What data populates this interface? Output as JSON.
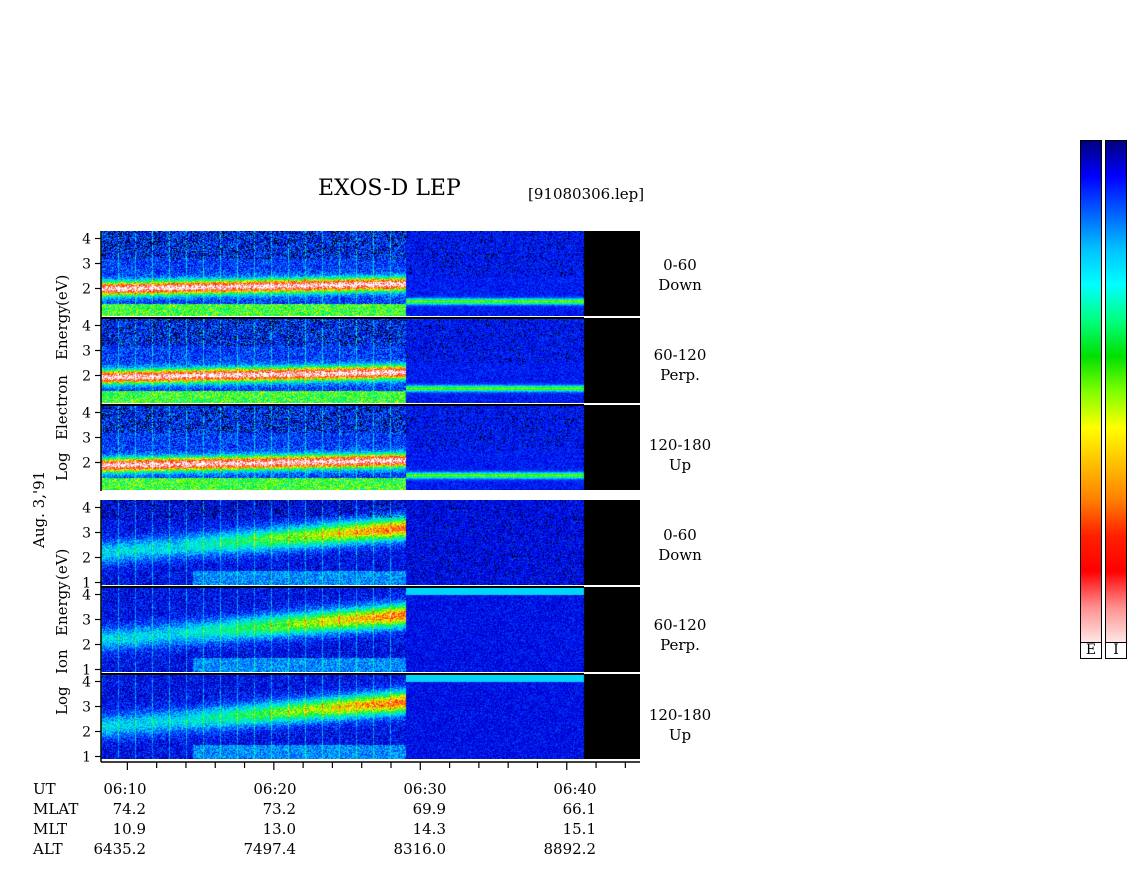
{
  "header": {
    "title": "EXOS-D LEP",
    "file_id": "[91080306.lep]"
  },
  "date_label": "Aug. 3,'91",
  "groups": [
    {
      "species": "Electron",
      "ylabel_parts": [
        "Log",
        "Electron",
        "Energy",
        "(eV)"
      ]
    },
    {
      "species": "Ion",
      "ylabel_parts": [
        "Log",
        "Ion",
        "Energy",
        "(eV)"
      ]
    }
  ],
  "panels": [
    {
      "group": "electron",
      "pitch_angle": "0-60",
      "direction": "Down"
    },
    {
      "group": "electron",
      "pitch_angle": "60-120",
      "direction": "Perp."
    },
    {
      "group": "electron",
      "pitch_angle": "120-180",
      "direction": "Up"
    },
    {
      "group": "ion",
      "pitch_angle": "0-60",
      "direction": "Down"
    },
    {
      "group": "ion",
      "pitch_angle": "60-120",
      "direction": "Perp."
    },
    {
      "group": "ion",
      "pitch_angle": "120-180",
      "direction": "Up"
    }
  ],
  "ephemeris": {
    "row_names": [
      "UT",
      "MLAT",
      "MLT",
      "ALT"
    ],
    "times": [
      "06:10",
      "06:20",
      "06:30",
      "06:40"
    ],
    "MLAT": [
      "74.2",
      "73.2",
      "69.9",
      "66.1"
    ],
    "MLT": [
      "10.9",
      "13.0",
      "14.3",
      "15.1"
    ],
    "ALT": [
      "6435.2",
      "7497.4",
      "8316.0",
      "8892.2"
    ]
  },
  "colorbar": {
    "labels": [
      "E",
      "I"
    ],
    "colors": [
      "#000080",
      "#0000ff",
      "#0060ff",
      "#00c0ff",
      "#00ffff",
      "#00ff80",
      "#00e000",
      "#80ff00",
      "#ffff00",
      "#ffc000",
      "#ff8000",
      "#ff2000",
      "#ff0000",
      "#ff9090",
      "#ffe8e8"
    ]
  },
  "chart_data": {
    "type": "heatmap",
    "title": "EXOS-D LEP",
    "xlabel": "UT",
    "ylabel": "Log Energy (eV)",
    "x_ticks": [
      "06:10",
      "06:20",
      "06:30",
      "06:40"
    ],
    "xlim_minutes_after_0600": [
      8.2,
      45
    ],
    "data_end_minutes_after_0600": 41.2,
    "y_ticks": [
      "1",
      "2",
      "3",
      "4"
    ],
    "ylim": [
      1,
      4.2
    ],
    "colorscale": [
      "dark blue",
      "blue",
      "cyan",
      "green",
      "yellow",
      "orange",
      "red",
      "pink",
      "white"
    ],
    "panels": [
      {
        "name": "Electron 0-60 Down",
        "band_center_log_eV": 2.0,
        "intensity_before_0629": "high",
        "intensity_after_0629": "low"
      },
      {
        "name": "Electron 60-120 Perp.",
        "band_center_log_eV": 1.95,
        "intensity_before_0629": "high",
        "intensity_after_0629": "low"
      },
      {
        "name": "Electron 120-180 Up",
        "band_center_log_eV": 1.9,
        "intensity_before_0629": "high",
        "intensity_after_0629": "low"
      },
      {
        "name": "Ion 0-60 Down",
        "band_center_log_eV": 3.0,
        "intensity_before_0629": "medium-high",
        "intensity_after_0629": "background"
      },
      {
        "name": "Ion 60-120 Perp.",
        "band_center_log_eV": 3.0,
        "intensity_before_0629": "medium-high",
        "intensity_after_0629": "background"
      },
      {
        "name": "Ion 120-180 Up",
        "band_center_log_eV": 3.0,
        "intensity_before_0629": "medium-high",
        "intensity_after_0629": "background"
      }
    ]
  }
}
